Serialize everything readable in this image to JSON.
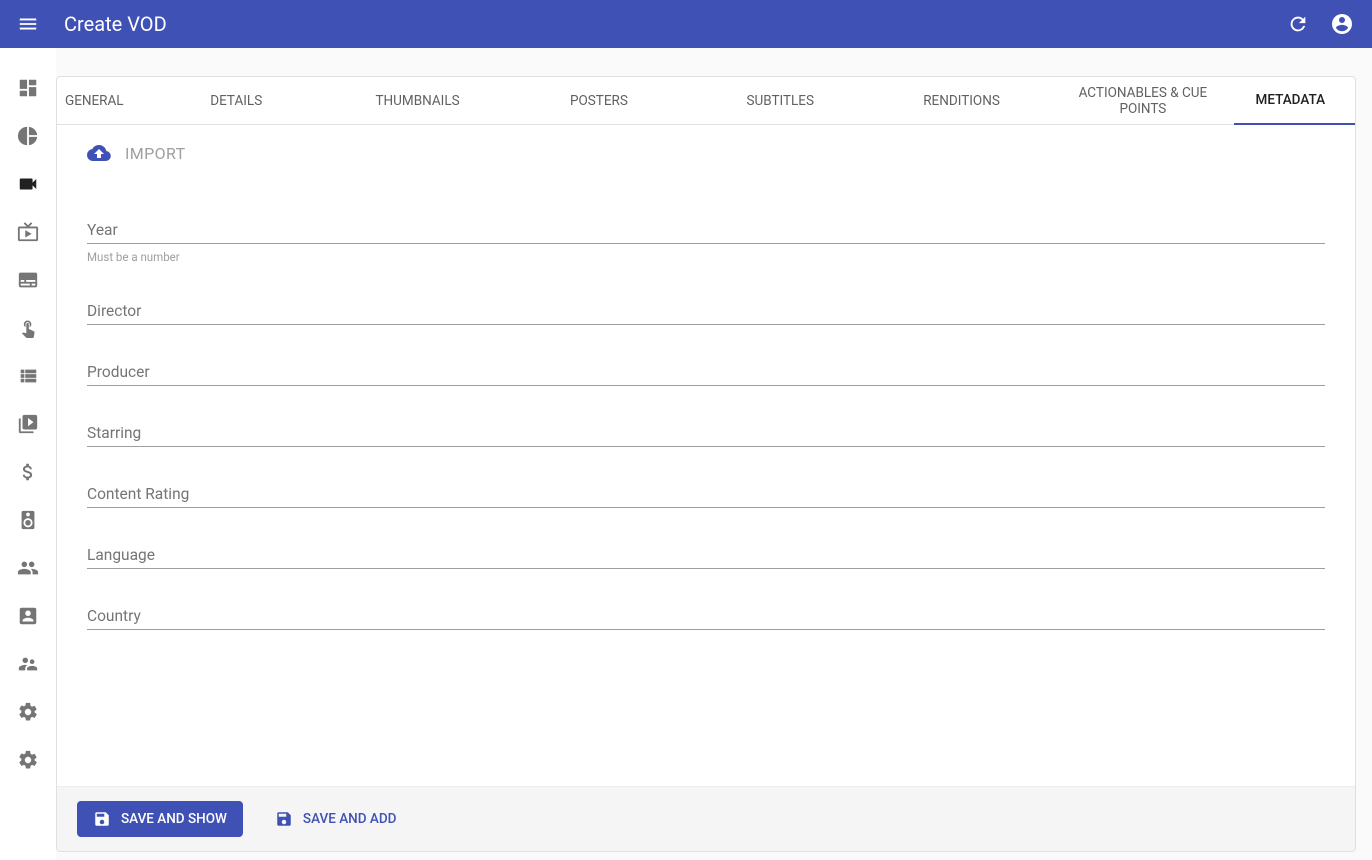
{
  "header": {
    "title": "Create VOD"
  },
  "tabs": [
    {
      "label": "GENERAL"
    },
    {
      "label": "DETAILS"
    },
    {
      "label": "THUMBNAILS"
    },
    {
      "label": "POSTERS"
    },
    {
      "label": "SUBTITLES"
    },
    {
      "label": "RENDITIONS"
    },
    {
      "label": "ACTIONABLES & CUE POINTS"
    },
    {
      "label": "METADATA"
    }
  ],
  "import_label": "IMPORT",
  "fields": {
    "year": {
      "placeholder": "Year",
      "helper": "Must be a number"
    },
    "director": {
      "placeholder": "Director"
    },
    "producer": {
      "placeholder": "Producer"
    },
    "starring": {
      "placeholder": "Starring"
    },
    "content_rating": {
      "placeholder": "Content Rating"
    },
    "language": {
      "placeholder": "Language"
    },
    "country": {
      "placeholder": "Country"
    }
  },
  "actions": {
    "save_show": "SAVE AND SHOW",
    "save_add": "SAVE AND ADD"
  }
}
